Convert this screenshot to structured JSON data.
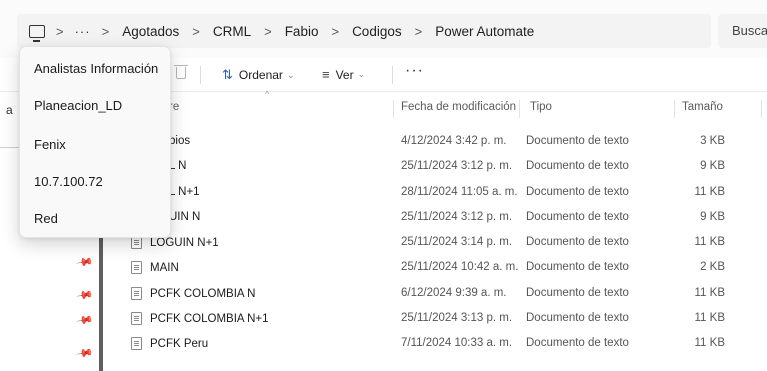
{
  "address_bar": {
    "overflow": "···",
    "crumbs": [
      "Agotados",
      "CRML",
      "Fabio",
      "Codigos",
      "Power Automate"
    ],
    "separator": ">"
  },
  "search": {
    "placeholder": "Busca"
  },
  "command_bar": {
    "sort_label": "Ordenar",
    "view_label": "Ver",
    "more": "···",
    "sort_icon": "sort-arrows-icon",
    "view_icon": "view-lines-icon",
    "delete_icon": "trash-icon"
  },
  "nav": {
    "partial_label": "a"
  },
  "columns": {
    "name": "re",
    "date": "Fecha de modificación",
    "type": "Tipo",
    "size": "Tamaño"
  },
  "files": [
    {
      "name": "bios",
      "date": "4/12/2024 3:42 p. m.",
      "type": "Documento de texto",
      "size": "3 KB"
    },
    {
      "name": "L N",
      "date": "25/11/2024 3:12 p. m.",
      "type": "Documento de texto",
      "size": "9 KB"
    },
    {
      "name": "L N+1",
      "date": "28/11/2024 11:05 a. m.",
      "type": "Documento de texto",
      "size": "11 KB"
    },
    {
      "name": "UIN N",
      "date": "25/11/2024 3:12 p. m.",
      "type": "Documento de texto",
      "size": "9 KB"
    },
    {
      "name": "LOGUIN N+1",
      "date": "25/11/2024 3:14 p. m.",
      "type": "Documento de texto",
      "size": "11 KB"
    },
    {
      "name": "MAIN",
      "date": "25/11/2024 10:42 a. m.",
      "type": "Documento de texto",
      "size": "2 KB"
    },
    {
      "name": "PCFK COLOMBIA N",
      "date": "6/12/2024 9:39 a. m.",
      "type": "Documento de texto",
      "size": "11 KB"
    },
    {
      "name": "PCFK COLOMBIA N+1",
      "date": "25/11/2024 3:13 p. m.",
      "type": "Documento de texto",
      "size": "11 KB"
    },
    {
      "name": "PCFK Peru",
      "date": "7/11/2024 10:33 a. m.",
      "type": "Documento de texto",
      "size": "11 KB"
    }
  ],
  "flyout": {
    "items": [
      "Analistas Información",
      "Planeacion_LD",
      "Fenix",
      "10.7.100.72",
      "Red"
    ]
  },
  "colors": {
    "accent": "#2b5fb3",
    "splitter": "#5f5f5f"
  }
}
